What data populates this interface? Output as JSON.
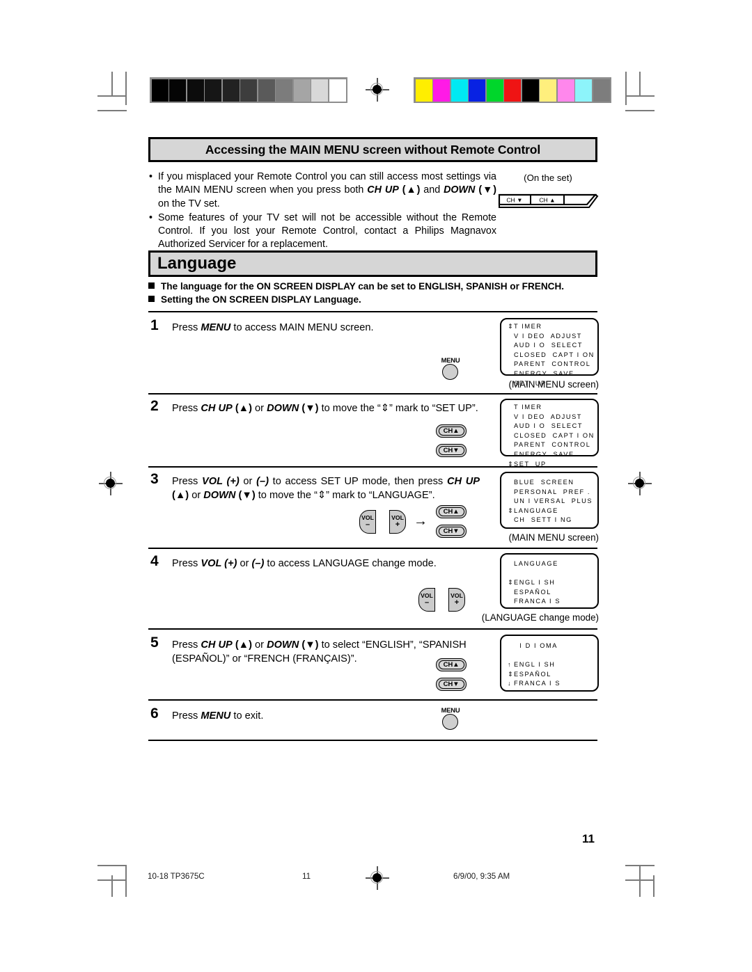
{
  "header_band": {
    "title": "Accessing the MAIN MENU screen without Remote Control"
  },
  "intro": {
    "bullet_char": "•",
    "items": [
      {
        "segments": [
          {
            "t": "If you misplaced your Remote Control you can still access most settings via the MAIN MENU screen when you press both ",
            "s": "n"
          },
          {
            "t": "CH UP",
            "s": "bi"
          },
          {
            "t": " (▲)",
            "s": "b"
          },
          {
            "t": " and ",
            "s": "n"
          },
          {
            "t": "DOWN",
            "s": "bi"
          },
          {
            "t": " (▼)",
            "s": "b"
          },
          {
            "t": " on the TV set.",
            "s": "n"
          }
        ]
      },
      {
        "segments": [
          {
            "t": "Some features of your TV set will not be accessible without the Remote Control.  If you lost your Remote Control, contact a Philips Magnavox Authorized Servicer for a replacement.",
            "s": "n"
          }
        ]
      }
    ]
  },
  "onset": {
    "caption": "(On the set)",
    "buttons": [
      "CH ▼",
      "CH ▲"
    ]
  },
  "language_band": {
    "title": "Language"
  },
  "notes": [
    "The language for the ON SCREEN DISPLAY can be set to ENGLISH, SPANISH or FRENCH.",
    "Setting the ON SCREEN DISPLAY Language."
  ],
  "steps": [
    {
      "num": "1",
      "segments": [
        {
          "t": "Press ",
          "s": "n"
        },
        {
          "t": "MENU",
          "s": "bi"
        },
        {
          "t": " to access MAIN MENU screen.",
          "s": "n"
        }
      ],
      "controls": [
        "menu-button"
      ]
    },
    {
      "num": "2",
      "segments": [
        {
          "t": "Press ",
          "s": "n"
        },
        {
          "t": "CH UP",
          "s": "bi"
        },
        {
          "t": " (▲)",
          "s": "b"
        },
        {
          "t": " or ",
          "s": "n"
        },
        {
          "t": "DOWN",
          "s": "bi"
        },
        {
          "t": " (▼)",
          "s": "b"
        },
        {
          "t": " to move the “⇕” mark to “SET UP”.",
          "s": "n"
        }
      ],
      "controls": [
        "ch-up-button",
        "ch-down-button"
      ]
    },
    {
      "num": "3",
      "segments": [
        {
          "t": "Press ",
          "s": "n"
        },
        {
          "t": "VOL (+)",
          "s": "bi"
        },
        {
          "t": " or ",
          "s": "n"
        },
        {
          "t": "(–)",
          "s": "bi"
        },
        {
          "t": " to access SET UP mode, then press ",
          "s": "n"
        },
        {
          "t": "CH UP",
          "s": "bi"
        },
        {
          "t": " (▲)",
          "s": "b"
        },
        {
          "t": " or ",
          "s": "n"
        },
        {
          "t": "DOWN",
          "s": "bi"
        },
        {
          "t": " (▼)",
          "s": "b"
        },
        {
          "t": " to move the “⇕” mark to “LANGUAGE”.",
          "s": "n"
        }
      ],
      "controls": [
        "vol-down-button",
        "vol-up-button",
        "arrow",
        "ch-up-button",
        "ch-down-button"
      ]
    },
    {
      "num": "4",
      "segments": [
        {
          "t": "Press ",
          "s": "n"
        },
        {
          "t": "VOL (+)",
          "s": "bi"
        },
        {
          "t": " or ",
          "s": "n"
        },
        {
          "t": "(–)",
          "s": "bi"
        },
        {
          "t": " to access LANGUAGE change mode.",
          "s": "n"
        }
      ],
      "controls": [
        "vol-down-button",
        "vol-up-button"
      ]
    },
    {
      "num": "5",
      "segments": [
        {
          "t": "Press ",
          "s": "n"
        },
        {
          "t": "CH UP",
          "s": "bi"
        },
        {
          "t": " (▲)",
          "s": "b"
        },
        {
          "t": " or ",
          "s": "n"
        },
        {
          "t": "DOWN",
          "s": "bi"
        },
        {
          "t": " (▼)",
          "s": "b"
        },
        {
          "t": " to select “ENGLISH”, “SPANISH (ESPAÑOL)” or “FRENCH (FRANÇAIS)”.",
          "s": "n"
        }
      ],
      "controls": [
        "ch-up-button",
        "ch-down-button"
      ]
    },
    {
      "num": "6",
      "segments": [
        {
          "t": "Press ",
          "s": "n"
        },
        {
          "t": "MENU",
          "s": "bi"
        },
        {
          "t": " to exit.",
          "s": "n"
        }
      ],
      "controls": [
        "menu-button"
      ]
    }
  ],
  "osd_screens": [
    {
      "id": "main-menu-1",
      "caption": "(MAIN MENU screen)",
      "lines": [
        {
          "mark": "⇕",
          "text": "T IMER"
        },
        {
          "mark": "",
          "text": "V I DEO  ADJUST"
        },
        {
          "mark": "",
          "text": "AUD I O  SELECT"
        },
        {
          "mark": "",
          "text": "CLOSED  CAPT I ON"
        },
        {
          "mark": "",
          "text": "PARENT  CONTROL"
        },
        {
          "mark": "",
          "text": "ENERGY  SAVE"
        },
        {
          "mark": "",
          "text": "SET  UP"
        }
      ]
    },
    {
      "id": "main-menu-2",
      "caption": "",
      "lines": [
        {
          "mark": "",
          "text": "T IMER"
        },
        {
          "mark": "",
          "text": "V I DEO  ADJUST"
        },
        {
          "mark": "",
          "text": "AUD I O  SELECT"
        },
        {
          "mark": "",
          "text": "CLOSED  CAPT I ON"
        },
        {
          "mark": "",
          "text": "PARENT  CONTROL"
        },
        {
          "mark": "",
          "text": "ENERGY  SAVE"
        },
        {
          "mark": "⇕",
          "text": "SET  UP"
        }
      ]
    },
    {
      "id": "set-up-menu",
      "caption": "(MAIN MENU screen)",
      "lines": [
        {
          "mark": "",
          "text": "BLUE  SCREEN"
        },
        {
          "mark": "",
          "text": "PERSONAL  PREF ."
        },
        {
          "mark": "",
          "text": "UN I VERSAL  PLUS"
        },
        {
          "mark": "⇕",
          "text": "LANGUAGE"
        },
        {
          "mark": "",
          "text": "CH  SETT I NG"
        }
      ]
    },
    {
      "id": "language-change",
      "caption": "(LANGUAGE change mode)",
      "lines": [
        {
          "mark": "",
          "text": "LANGUAGE"
        },
        {
          "mark": "",
          "text": ""
        },
        {
          "mark": "⇕",
          "text": "ENGL I SH"
        },
        {
          "mark": "",
          "text": "ESPAÑOL"
        },
        {
          "mark": "",
          "text": "FRANCA I S"
        }
      ]
    },
    {
      "id": "idioma-change",
      "caption": "",
      "lines": [
        {
          "mark": "",
          "text": "  I D I OMA"
        },
        {
          "mark": "",
          "text": ""
        },
        {
          "mark": "↑",
          "text": "ENGL I SH"
        },
        {
          "mark": "⇕",
          "text": "ESPAÑOL"
        },
        {
          "mark": "↓",
          "text": "FRANCA I S"
        }
      ]
    }
  ],
  "page_number": "11",
  "footer": {
    "left": "10-18 TP3675C",
    "center": "11",
    "right": "6/9/00, 9:35 AM"
  },
  "calibration": {
    "grayscale": [
      "#000000",
      "#050505",
      "#0c0c0c",
      "#161616",
      "#222222",
      "#3d3d3d",
      "#5a5a5a",
      "#7c7c7c",
      "#a5a5a5",
      "#d8d8d8",
      "#ffffff"
    ],
    "colors": [
      "#ffee00",
      "#ff1ae6",
      "#00e9f2",
      "#0822e3",
      "#00d62b",
      "#ef1414",
      "#000000",
      "#ffef7d",
      "#ff87ec",
      "#8df4fa",
      "#7d7d7d"
    ]
  }
}
